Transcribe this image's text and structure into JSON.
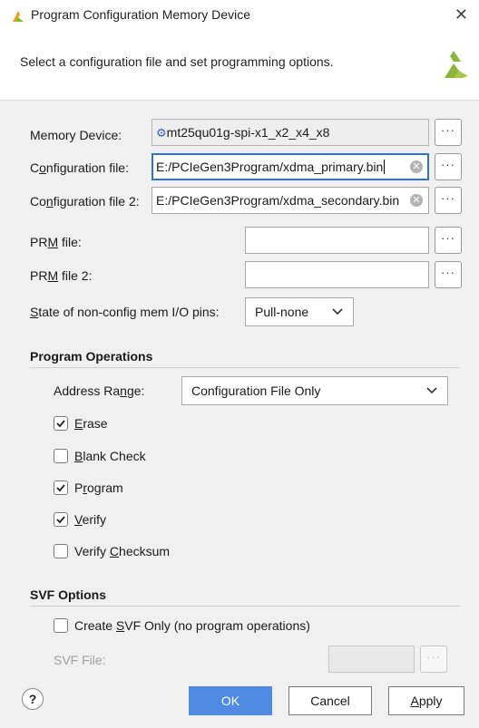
{
  "window": {
    "title": "Program Configuration Memory Device",
    "close_glyph": "✕"
  },
  "header": {
    "description": "Select a configuration file and set programming options."
  },
  "fields": {
    "memory_device": {
      "label": "Memory Device:",
      "value": "mt25qu01g-spi-x1_x2_x4_x8",
      "icon": "chip-icon"
    },
    "config_file": {
      "label_pre": "C",
      "label_u": "o",
      "label_post": "nfiguration file:",
      "value": "E:/PCIeGen3Program/xdma_primary.bin"
    },
    "config_file2": {
      "label_pre": "Co",
      "label_u": "n",
      "label_post": "figuration file 2:",
      "value": "E:/PCIeGen3Program/xdma_secondary.bin"
    },
    "prm_file": {
      "label_pre": "PR",
      "label_u": "M",
      "label_post": " file:",
      "value": ""
    },
    "prm_file2": {
      "label_pre": "PR",
      "label_u": "M",
      "label_post": " file 2:",
      "value": ""
    },
    "state_pins": {
      "label_u": "S",
      "label_post": "tate of non-config mem I/O pins:",
      "value": "Pull-none"
    },
    "browse_glyph": "···"
  },
  "program_operations": {
    "title": "Program Operations",
    "address_range": {
      "label_pre": "Address Ra",
      "label_u": "n",
      "label_post": "ge:",
      "value": "Configuration File Only"
    },
    "options": [
      {
        "label_pre": "",
        "label_u": "E",
        "label_post": "rase",
        "checked": true
      },
      {
        "label_pre": "",
        "label_u": "B",
        "label_post": "lank Check",
        "checked": false
      },
      {
        "label_pre": "P",
        "label_u": "r",
        "label_post": "ogram",
        "checked": true
      },
      {
        "label_pre": "",
        "label_u": "V",
        "label_post": "erify",
        "checked": true
      },
      {
        "label_pre": "Verify ",
        "label_u": "C",
        "label_post": "hecksum",
        "checked": false
      }
    ]
  },
  "svf_options": {
    "title": "SVF Options",
    "create_svf": {
      "label_pre": "Create ",
      "label_u": "S",
      "label_post": "VF Only (no program operations)",
      "checked": false
    },
    "svf_file": {
      "label": "SVF File:",
      "value": ""
    }
  },
  "buttons": {
    "help": "?",
    "ok": "OK",
    "cancel": "Cancel",
    "apply_u": "A",
    "apply_post": "pply"
  },
  "colors": {
    "accent": "#4f8be2",
    "focus": "#2f6fdc",
    "logo": "#8bb63a"
  }
}
